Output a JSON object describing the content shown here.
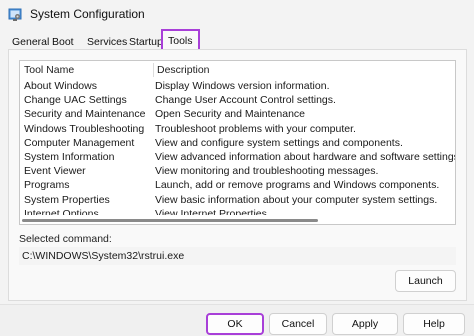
{
  "window": {
    "title": "System Configuration",
    "icon": "msconfig-icon"
  },
  "tabs": [
    {
      "label": "General",
      "active": false
    },
    {
      "label": "Boot",
      "active": false
    },
    {
      "label": "Services",
      "active": false
    },
    {
      "label": "Startup",
      "active": false
    },
    {
      "label": "Tools",
      "active": true
    }
  ],
  "tools_list": {
    "columns": [
      "Tool Name",
      "Description"
    ],
    "rows": [
      {
        "name": "About Windows",
        "description": "Display Windows version information."
      },
      {
        "name": "Change UAC Settings",
        "description": "Change User Account Control settings."
      },
      {
        "name": "Security and Maintenance",
        "description": "Open Security and Maintenance"
      },
      {
        "name": "Windows Troubleshooting",
        "description": "Troubleshoot problems with your computer."
      },
      {
        "name": "Computer Management",
        "description": "View and configure system settings and components."
      },
      {
        "name": "System Information",
        "description": "View advanced information about hardware and software settings."
      },
      {
        "name": "Event Viewer",
        "description": "View monitoring and troubleshooting messages."
      },
      {
        "name": "Programs",
        "description": "Launch, add or remove programs and Windows components."
      },
      {
        "name": "System Properties",
        "description": "View basic information about your computer system settings."
      },
      {
        "name": "Internet Options",
        "description": "View Internet Properties."
      }
    ]
  },
  "selected_command": {
    "label": "Selected command:",
    "value": "C:\\WINDOWS\\System32\\rstrui.exe"
  },
  "buttons": {
    "launch": "Launch",
    "ok": "OK",
    "cancel": "Cancel",
    "apply": "Apply",
    "help": "Help"
  },
  "colors": {
    "highlight": "#a83fd8"
  }
}
